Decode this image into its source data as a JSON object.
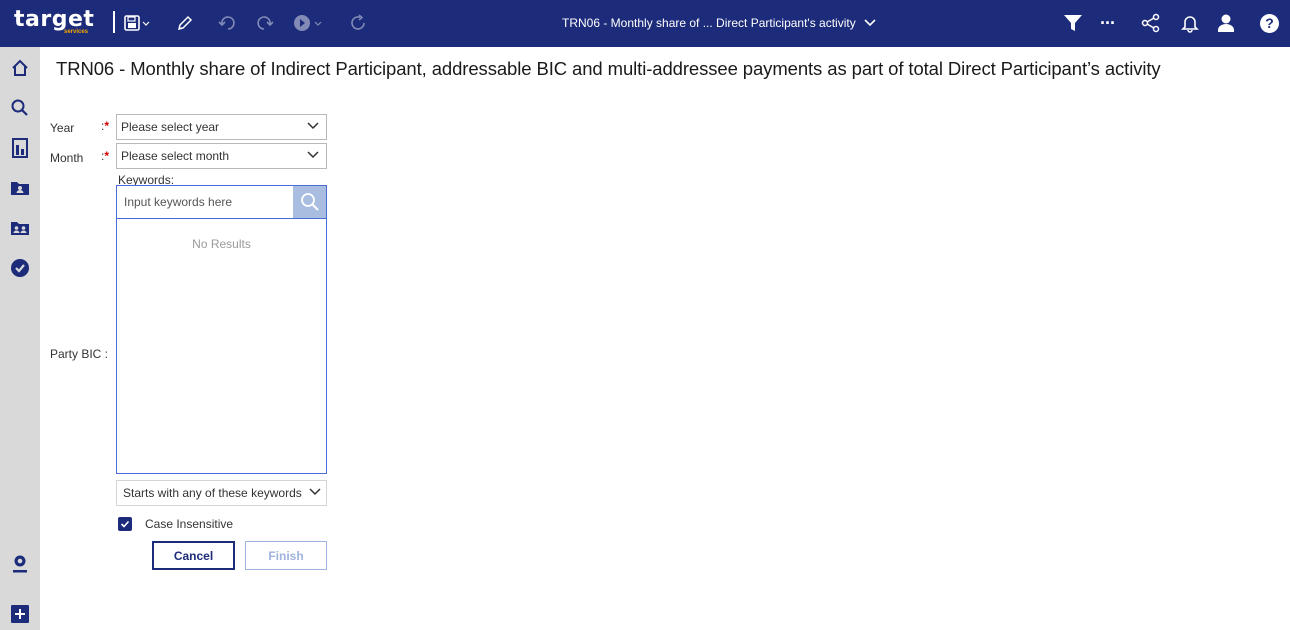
{
  "header": {
    "logo_text": "target",
    "logo_sub": "services",
    "report_title": "TRN06 - Monthly share of ... Direct Participant's activity",
    "icons": [
      "save-icon",
      "pencil-icon",
      "undo-icon",
      "redo-icon",
      "run-icon",
      "refresh-icon",
      "filter-icon",
      "more-icon",
      "share-icon",
      "bell-icon",
      "user-icon",
      "help-icon"
    ],
    "more_glyph": "···",
    "help_glyph": "?"
  },
  "sidebar": {
    "items": [
      "home-icon",
      "search-icon",
      "reports-icon",
      "my-content-icon",
      "team-content-icon",
      "recent-icon",
      "profile-icon",
      "add-icon"
    ]
  },
  "page": {
    "title": "TRN06 - Monthly share of Indirect Participant, addressable BIC and multi-addressee payments as part of total Direct Participant’s activity"
  },
  "form": {
    "year_label": "Year",
    "year_placeholder": "Please select year",
    "month_label": "Month",
    "month_placeholder": "Please select month",
    "required_colon": ":",
    "required_star": "*",
    "keywords_label": "Keywords:",
    "keywords_placeholder": "Input keywords here",
    "no_results": "No Results",
    "party_bic_label": "Party BIC :",
    "match_mode": "Starts with any of these keywords",
    "case_insensitive_label": "Case Insensitive",
    "case_insensitive_checked": true,
    "cancel_label": "Cancel",
    "finish_label": "Finish"
  },
  "colors": {
    "header_bg": "#1c2b7a",
    "rail_bg": "#d9d9d9",
    "accent": "#4a6bd8",
    "required": "#d10000",
    "logo_accent": "#f6a800"
  }
}
